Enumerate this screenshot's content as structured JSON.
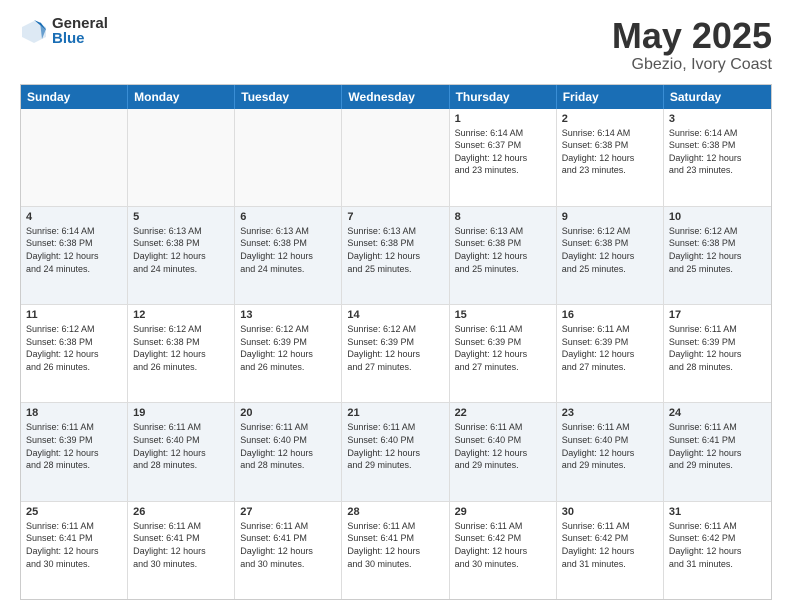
{
  "logo": {
    "general": "General",
    "blue": "Blue"
  },
  "title": "May 2025",
  "subtitle": "Gbezio, Ivory Coast",
  "weekdays": [
    "Sunday",
    "Monday",
    "Tuesday",
    "Wednesday",
    "Thursday",
    "Friday",
    "Saturday"
  ],
  "rows": [
    [
      {
        "day": "",
        "text": "",
        "empty": true
      },
      {
        "day": "",
        "text": "",
        "empty": true
      },
      {
        "day": "",
        "text": "",
        "empty": true
      },
      {
        "day": "",
        "text": "",
        "empty": true
      },
      {
        "day": "1",
        "text": "Sunrise: 6:14 AM\nSunset: 6:37 PM\nDaylight: 12 hours\nand 23 minutes."
      },
      {
        "day": "2",
        "text": "Sunrise: 6:14 AM\nSunset: 6:38 PM\nDaylight: 12 hours\nand 23 minutes."
      },
      {
        "day": "3",
        "text": "Sunrise: 6:14 AM\nSunset: 6:38 PM\nDaylight: 12 hours\nand 23 minutes."
      }
    ],
    [
      {
        "day": "4",
        "text": "Sunrise: 6:14 AM\nSunset: 6:38 PM\nDaylight: 12 hours\nand 24 minutes."
      },
      {
        "day": "5",
        "text": "Sunrise: 6:13 AM\nSunset: 6:38 PM\nDaylight: 12 hours\nand 24 minutes."
      },
      {
        "day": "6",
        "text": "Sunrise: 6:13 AM\nSunset: 6:38 PM\nDaylight: 12 hours\nand 24 minutes."
      },
      {
        "day": "7",
        "text": "Sunrise: 6:13 AM\nSunset: 6:38 PM\nDaylight: 12 hours\nand 25 minutes."
      },
      {
        "day": "8",
        "text": "Sunrise: 6:13 AM\nSunset: 6:38 PM\nDaylight: 12 hours\nand 25 minutes."
      },
      {
        "day": "9",
        "text": "Sunrise: 6:12 AM\nSunset: 6:38 PM\nDaylight: 12 hours\nand 25 minutes."
      },
      {
        "day": "10",
        "text": "Sunrise: 6:12 AM\nSunset: 6:38 PM\nDaylight: 12 hours\nand 25 minutes."
      }
    ],
    [
      {
        "day": "11",
        "text": "Sunrise: 6:12 AM\nSunset: 6:38 PM\nDaylight: 12 hours\nand 26 minutes."
      },
      {
        "day": "12",
        "text": "Sunrise: 6:12 AM\nSunset: 6:38 PM\nDaylight: 12 hours\nand 26 minutes."
      },
      {
        "day": "13",
        "text": "Sunrise: 6:12 AM\nSunset: 6:39 PM\nDaylight: 12 hours\nand 26 minutes."
      },
      {
        "day": "14",
        "text": "Sunrise: 6:12 AM\nSunset: 6:39 PM\nDaylight: 12 hours\nand 27 minutes."
      },
      {
        "day": "15",
        "text": "Sunrise: 6:11 AM\nSunset: 6:39 PM\nDaylight: 12 hours\nand 27 minutes."
      },
      {
        "day": "16",
        "text": "Sunrise: 6:11 AM\nSunset: 6:39 PM\nDaylight: 12 hours\nand 27 minutes."
      },
      {
        "day": "17",
        "text": "Sunrise: 6:11 AM\nSunset: 6:39 PM\nDaylight: 12 hours\nand 28 minutes."
      }
    ],
    [
      {
        "day": "18",
        "text": "Sunrise: 6:11 AM\nSunset: 6:39 PM\nDaylight: 12 hours\nand 28 minutes."
      },
      {
        "day": "19",
        "text": "Sunrise: 6:11 AM\nSunset: 6:40 PM\nDaylight: 12 hours\nand 28 minutes."
      },
      {
        "day": "20",
        "text": "Sunrise: 6:11 AM\nSunset: 6:40 PM\nDaylight: 12 hours\nand 28 minutes."
      },
      {
        "day": "21",
        "text": "Sunrise: 6:11 AM\nSunset: 6:40 PM\nDaylight: 12 hours\nand 29 minutes."
      },
      {
        "day": "22",
        "text": "Sunrise: 6:11 AM\nSunset: 6:40 PM\nDaylight: 12 hours\nand 29 minutes."
      },
      {
        "day": "23",
        "text": "Sunrise: 6:11 AM\nSunset: 6:40 PM\nDaylight: 12 hours\nand 29 minutes."
      },
      {
        "day": "24",
        "text": "Sunrise: 6:11 AM\nSunset: 6:41 PM\nDaylight: 12 hours\nand 29 minutes."
      }
    ],
    [
      {
        "day": "25",
        "text": "Sunrise: 6:11 AM\nSunset: 6:41 PM\nDaylight: 12 hours\nand 30 minutes."
      },
      {
        "day": "26",
        "text": "Sunrise: 6:11 AM\nSunset: 6:41 PM\nDaylight: 12 hours\nand 30 minutes."
      },
      {
        "day": "27",
        "text": "Sunrise: 6:11 AM\nSunset: 6:41 PM\nDaylight: 12 hours\nand 30 minutes."
      },
      {
        "day": "28",
        "text": "Sunrise: 6:11 AM\nSunset: 6:41 PM\nDaylight: 12 hours\nand 30 minutes."
      },
      {
        "day": "29",
        "text": "Sunrise: 6:11 AM\nSunset: 6:42 PM\nDaylight: 12 hours\nand 30 minutes."
      },
      {
        "day": "30",
        "text": "Sunrise: 6:11 AM\nSunset: 6:42 PM\nDaylight: 12 hours\nand 31 minutes."
      },
      {
        "day": "31",
        "text": "Sunrise: 6:11 AM\nSunset: 6:42 PM\nDaylight: 12 hours\nand 31 minutes."
      }
    ]
  ]
}
